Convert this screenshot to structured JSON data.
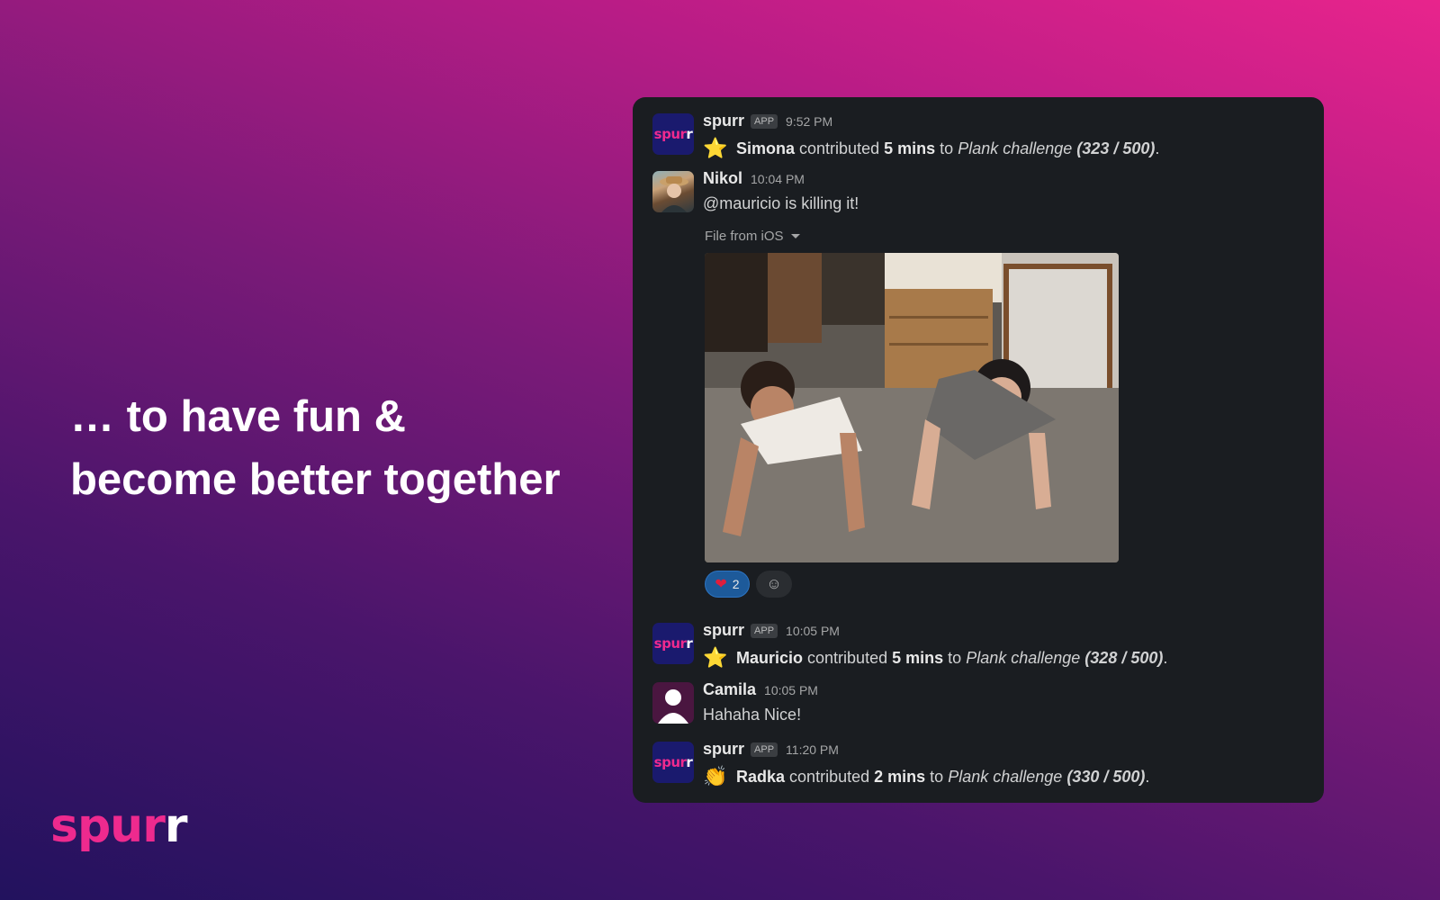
{
  "tagline": {
    "line1": "… to have fun &",
    "line2": "become better together"
  },
  "brand": {
    "logo_main": "spur",
    "logo_last": "r"
  },
  "messages": [
    {
      "name": "spurr",
      "badge": "APP",
      "time": "9:52 PM",
      "emoji": "⭐",
      "user": "Simona",
      "verb": "contributed",
      "amount": "5 mins",
      "to": "to",
      "challenge": "Plank challenge",
      "progress": "(323 / 500)"
    },
    {
      "name": "Nikol",
      "time": "10:04 PM",
      "text": "@mauricio is killing it!",
      "file_label": "File from iOS"
    },
    {
      "name": "spurr",
      "badge": "APP",
      "time": "10:05 PM",
      "emoji": "⭐",
      "user": "Mauricio",
      "verb": "contributed",
      "amount": "5 mins",
      "to": "to",
      "challenge": "Plank challenge",
      "progress": "(328 / 500)"
    },
    {
      "name": "Camila",
      "time": "10:05 PM",
      "text": "Hahaha Nice!"
    },
    {
      "name": "spurr",
      "badge": "APP",
      "time": "11:20 PM",
      "emoji": "👏",
      "user": "Radka",
      "verb": "contributed",
      "amount": "2 mins",
      "to": "to",
      "challenge": "Plank challenge",
      "progress": "(330 / 500)"
    }
  ],
  "reactions": {
    "heart_count": "2",
    "heart_emoji": "❤",
    "add_icon": "☺"
  },
  "colors": {
    "accent_pink": "#ee2a8e",
    "panel_bg": "#1a1d21",
    "reaction_blue": "#1d5a9a"
  }
}
